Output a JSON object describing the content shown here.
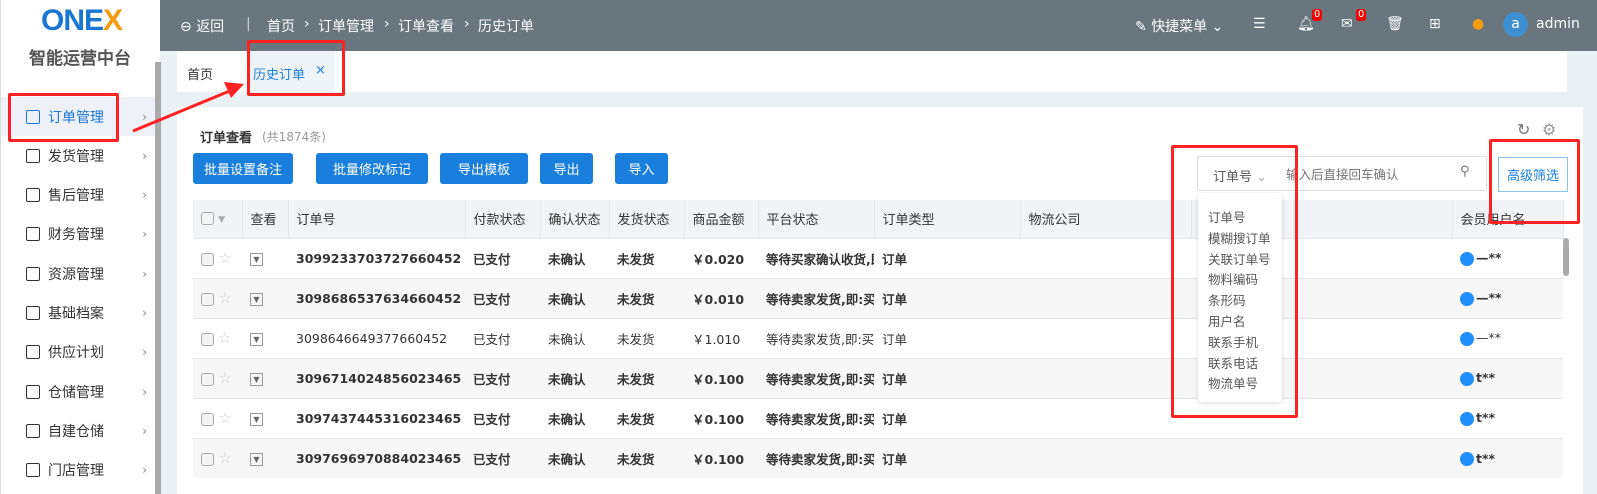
{
  "sidebar": {
    "logo": "ONEX",
    "brand": "智能运营中台",
    "items": [
      {
        "label": "订单管理"
      },
      {
        "label": "发货管理"
      },
      {
        "label": "售后管理"
      },
      {
        "label": "财务管理"
      },
      {
        "label": "资源管理"
      },
      {
        "label": "基础档案"
      },
      {
        "label": "供应计划"
      },
      {
        "label": "仓储管理"
      },
      {
        "label": "自建仓储"
      },
      {
        "label": "门店管理"
      }
    ]
  },
  "topbar": {
    "back": "返回",
    "breadcrumb": [
      "首页",
      "订单管理",
      "订单查看",
      "历史订单"
    ],
    "quick_menu": "快捷菜单",
    "bell_count": "0",
    "mail_count": "0",
    "avatar": "a",
    "user": "admin"
  },
  "tabs": {
    "home": "首页",
    "active": "历史订单",
    "close": "×"
  },
  "main": {
    "title": "订单查看",
    "count": "(共1874条)",
    "buttons": [
      "批量设置备注",
      "批量修改标记",
      "导出模板",
      "导出",
      "导入"
    ],
    "search": {
      "field": "订单号",
      "placeholder": "输入后直接回车确认"
    },
    "advanced": "高级筛选",
    "search_options": [
      "订单号",
      "模糊搜订单",
      "关联订单号",
      "物料编码",
      "条形码",
      "用户名",
      "联系手机",
      "联系电话",
      "物流单号"
    ]
  },
  "table": {
    "headers": [
      "查看",
      "订单号",
      "付款状态",
      "确认状态",
      "发货状态",
      "商品金额",
      "平台状态",
      "订单类型",
      "物流公司",
      "",
      "会员用户名"
    ],
    "rows": [
      {
        "id": "3099233703727660452",
        "pay": "已支付",
        "confirm": "未确认",
        "ship": "未发货",
        "amount": "￥0.020",
        "platform": "等待买家确认收货,即:",
        "type": "订单",
        "user": "—**"
      },
      {
        "id": "3098686537634660452",
        "pay": "已支付",
        "confirm": "未确认",
        "ship": "未发货",
        "amount": "￥0.010",
        "platform": "等待卖家发货,即:买家",
        "type": "订单",
        "user": "—**"
      },
      {
        "id": "3098646649377660452",
        "pay": "已支付",
        "confirm": "未确认",
        "ship": "未发货",
        "amount": "￥1.010",
        "platform": "等待卖家发货,即:买家",
        "type": "订单",
        "user": "—**"
      },
      {
        "id": "3096714024856023465",
        "pay": "已支付",
        "confirm": "未确认",
        "ship": "未发货",
        "amount": "￥0.100",
        "platform": "等待卖家发货,即:买家",
        "type": "订单",
        "user": "t**"
      },
      {
        "id": "3097437445316023465",
        "pay": "已支付",
        "confirm": "未确认",
        "ship": "未发货",
        "amount": "￥0.100",
        "platform": "等待卖家发货,即:买家",
        "type": "订单",
        "user": "t**"
      },
      {
        "id": "3097696970884023465",
        "pay": "已支付",
        "confirm": "未确认",
        "ship": "未发货",
        "amount": "￥0.100",
        "platform": "等待卖家发货,即:买家",
        "type": "订单",
        "user": "t**"
      }
    ]
  },
  "colors": {
    "accent": "#1a7fdc",
    "topbar": "#69767d",
    "annotation": "#ff2222"
  }
}
